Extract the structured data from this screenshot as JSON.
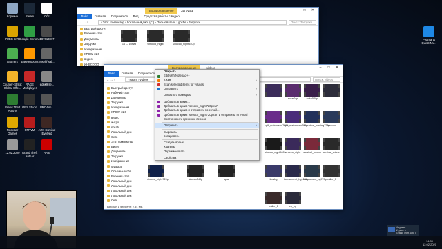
{
  "desktop_left": [
    {
      "label": "Корзина",
      "color": "#8ea7c4"
    },
    {
      "label": "Steam",
      "color": "#1b2838"
    },
    {
      "label": "Обс",
      "color": "#ffffff"
    },
    {
      "label": "PUBG LITE",
      "color": "#d9a400"
    },
    {
      "label": "Google Chrome",
      "color": "#2f9e44"
    },
    {
      "label": "187013877",
      "color": "#4a4a4a"
    },
    {
      "label": "µTorrent",
      "color": "#4caf50"
    },
    {
      "label": "Easy eSports",
      "color": "#ff9800"
    },
    {
      "label": "Msyhf-sal...",
      "color": "#666"
    },
    {
      "label": "Counter-Strike: Global Offe...",
      "color": "#f2b32a"
    },
    {
      "label": "RAGE Multiplayer",
      "color": "#c62828"
    },
    {
      "label": "eduk9fse...",
      "color": "#888"
    },
    {
      "label": "Grand Theft Auto V",
      "color": "#2e7d32"
    },
    {
      "label": "OBS Studio",
      "color": "#303030"
    },
    {
      "label": "PROAim...",
      "color": "#555"
    },
    {
      "label": "Rockstar Games",
      "color": "#e0a800"
    },
    {
      "label": "CTRVM",
      "color": "#b71c1c"
    },
    {
      "label": "ARK Survival Evolved",
      "color": "#3e2723"
    },
    {
      "label": "12.02.2020",
      "color": "#999"
    },
    {
      "label": "Grand Theft Auto V",
      "color": "#222"
    },
    {
      "label": "RAIE",
      "color": "#c00"
    }
  ],
  "desktop_right": [
    {
      "label": "Peamarts Quest NV...",
      "color": "#1e88e5"
    }
  ],
  "win_back": {
    "context_tab": "Воспроизведение",
    "title": "Загрузки",
    "ribbon": [
      "Файл",
      "Главная",
      "Поделиться",
      "Вид",
      "Средства работы с видео"
    ],
    "path": "› Этот компьютер › Локальный диск (C:) › Пользователи › goshe › Загрузки",
    "search": "Поиск: Загрузки",
    "side": [
      "Быстрый доступ",
      "Рабочий стол",
      "Документы",
      "Загрузки",
      "Изображения",
      "KPOW v1.0",
      "видео",
      "ИНВСООО"
    ],
    "tiles": [
      "16 — копия",
      "sinocco_night",
      "sinocco_night540p"
    ]
  },
  "win_front": {
    "context_tab": "Воспроизведение",
    "title": "videos",
    "ribbon": [
      "Файл",
      "Главная",
      "Поделиться",
      "Вид",
      "Средства работы с видео"
    ],
    "path": "› steam › videos",
    "search": "Поиск: videos",
    "side": [
      "Быстрый доступ",
      "Рабочий стол",
      "Документы",
      "Загрузки",
      "Изображения",
      "KPOW v1.0",
      "видео",
      "интро",
      "sosati",
      "Локальный дис",
      "",
      "Сеть",
      "Этот компьютер",
      "Видео",
      "Документы",
      "Загрузки",
      "Изображения",
      "Музыка",
      "Объемные объ",
      "Рабочий стол",
      "Локальный дис",
      "Локальный дис",
      "Локальный дис",
      "Локальный дис",
      "Сеть"
    ],
    "tiles_right": [
      "",
      "nuke74p",
      "nuke540p",
      "",
      "sp9_mainmenu720p",
      "sp9_mainmenu720p",
      "operation_loading720p",
      "sirocco",
      "sirocco_night540p",
      "sirocco_night",
      "survival_promo",
      "survival_winner",
      "tilesbg",
      "tournament_bg1080p",
      "tournament_bg720p",
      "trailer_0",
      "trailer_1",
      "cs_bg"
    ],
    "tiles_left": [
      "sirocco_night720p",
      "sirocco540p",
      "splat"
    ],
    "status": "Выбран 1 элемент: 2,54 МБ"
  },
  "menu": {
    "items": [
      {
        "label": "Открыть",
        "bold": true,
        "icon": "",
        "arrow": false
      },
      {
        "label": "Edit with Notepad++",
        "icon": "#2e7d32",
        "arrow": false
      },
      {
        "label": "AIMP",
        "icon": "#f57c00",
        "arrow": true
      },
      {
        "label": "Scan selected items for viruses",
        "icon": "#d32f2f",
        "arrow": false
      },
      {
        "label": "Отправить",
        "icon": "#1976d2",
        "arrow": true
      },
      {
        "sep": true
      },
      {
        "label": "Открыть с помощью",
        "icon": "",
        "arrow": true
      },
      {
        "sep": true
      },
      {
        "label": "Добавить в архив...",
        "icon": "#8e24aa",
        "arrow": false
      },
      {
        "label": "Добавить в архив \"sirocco_night720p.rar\"",
        "icon": "#8e24aa",
        "arrow": false
      },
      {
        "label": "Добавить в архив и отправить по e-mail...",
        "icon": "#8e24aa",
        "arrow": false
      },
      {
        "label": "Добавить в архив \"sirocco_night720p.rar\" и отправить по e-mail",
        "icon": "#8e24aa",
        "arrow": false
      },
      {
        "label": "Восстановить прежнюю версию",
        "icon": "",
        "arrow": false
      },
      {
        "sep": true
      },
      {
        "label": "Отправить",
        "icon": "",
        "arrow": true
      },
      {
        "sep": true
      },
      {
        "label": "Вырезать",
        "icon": "",
        "arrow": false
      },
      {
        "label": "Копировать",
        "icon": "",
        "arrow": false
      },
      {
        "sep": true
      },
      {
        "label": "Создать ярлык",
        "icon": "",
        "arrow": false
      },
      {
        "label": "Удалить",
        "icon": "",
        "arrow": false
      },
      {
        "label": "Переименовать",
        "icon": "",
        "arrow": false
      },
      {
        "sep": true
      },
      {
        "label": "Свойства",
        "icon": "",
        "arrow": false
      }
    ]
  },
  "toast": {
    "line1": "Андзели",
    "line2": "Играет в",
    "line3": "Grand Theft Auto V"
  },
  "clock": {
    "time": "14:30",
    "date": "12.02.2020"
  }
}
